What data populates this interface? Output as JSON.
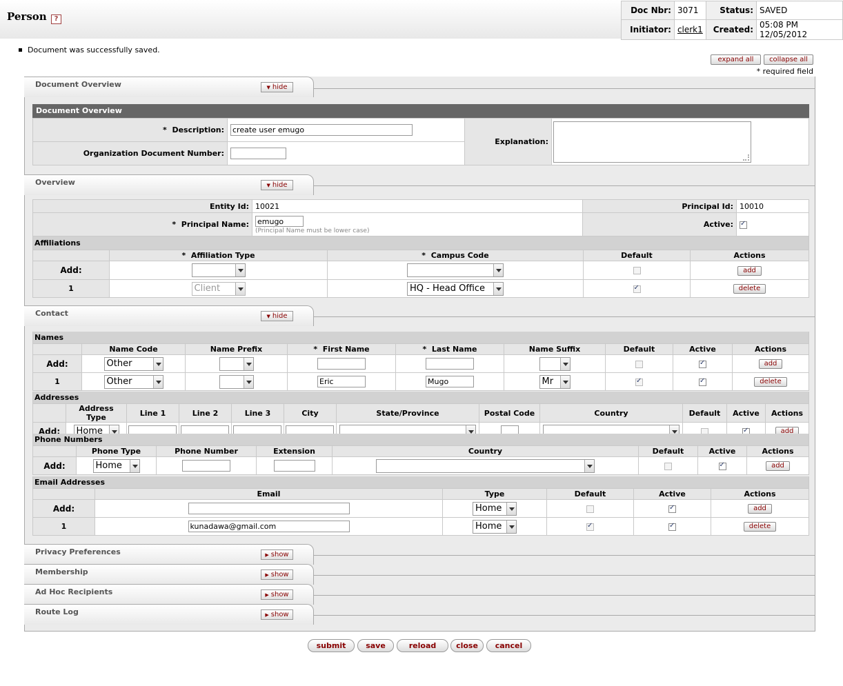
{
  "header": {
    "title": "Person",
    "help": "?",
    "doc_nbr_label": "Doc Nbr:",
    "doc_nbr": "3071",
    "status_label": "Status:",
    "status": "SAVED",
    "initiator_label": "Initiator:",
    "initiator": "clerk1",
    "created_label": "Created:",
    "created": "05:08 PM 12/05/2012"
  },
  "message": "Document was successfully saved.",
  "expand_all": "expand all",
  "collapse_all": "collapse all",
  "required_note": "* required field",
  "tabs": {
    "doc_overview": {
      "label": "Document Overview",
      "btn": "hide"
    },
    "overview": {
      "label": "Overview",
      "btn": "hide"
    },
    "contact": {
      "label": "Contact",
      "btn": "hide"
    },
    "privacy": {
      "label": "Privacy Preferences",
      "btn": "show"
    },
    "membership": {
      "label": "Membership",
      "btn": "show"
    },
    "adhoc": {
      "label": "Ad Hoc Recipients",
      "btn": "show"
    },
    "routelog": {
      "label": "Route Log",
      "btn": "show"
    }
  },
  "doc_overview": {
    "title": "Document Overview",
    "description_label": "Description:",
    "description": "create user emugo",
    "org_doc_label": "Organization Document Number:",
    "org_doc": "",
    "explanation_label": "Explanation:"
  },
  "overview": {
    "entity_id_label": "Entity Id:",
    "entity_id": "10021",
    "principal_id_label": "Principal Id:",
    "principal_id": "10010",
    "principal_name_label": "Principal Name:",
    "principal_name": "emugo",
    "principal_hint": "(Principal Name must be lower case)",
    "active_label": "Active:"
  },
  "affiliations": {
    "title": "Affiliations",
    "cols": [
      "Affiliation Type",
      "Campus Code",
      "Default",
      "Actions"
    ],
    "add_label": "Add:",
    "row_num": "1",
    "row_type": "Client",
    "row_campus": "HQ - Head Office",
    "add_btn": "add",
    "delete_btn": "delete"
  },
  "names": {
    "title": "Names",
    "cols": [
      "Name Code",
      "Name Prefix",
      "First Name",
      "Last Name",
      "Name Suffix",
      "Default",
      "Active",
      "Actions"
    ],
    "add_label": "Add:",
    "add_code": "Other",
    "row_num": "1",
    "row_code": "Other",
    "row_first": "Eric",
    "row_last": "Mugo",
    "row_suffix": "Mr",
    "add_btn": "add",
    "delete_btn": "delete"
  },
  "addresses": {
    "title": "Addresses",
    "cols": [
      "Address Type",
      "Line 1",
      "Line 2",
      "Line 3",
      "City",
      "State/Province",
      "Postal Code",
      "Country",
      "Default",
      "Active",
      "Actions"
    ],
    "add_label": "Add:",
    "add_type": "Home",
    "add_btn": "add"
  },
  "phones": {
    "title": "Phone Numbers",
    "cols": [
      "Phone Type",
      "Phone Number",
      "Extension",
      "Country",
      "Default",
      "Active",
      "Actions"
    ],
    "add_label": "Add:",
    "add_type": "Home",
    "add_btn": "add"
  },
  "emails": {
    "title": "Email Addresses",
    "cols": [
      "Email",
      "Type",
      "Default",
      "Active",
      "Actions"
    ],
    "add_label": "Add:",
    "add_type": "Home",
    "row_num": "1",
    "row_email": "kunadawa@gmail.com",
    "row_type": "Home",
    "add_btn": "add",
    "delete_btn": "delete"
  },
  "bottom_buttons": [
    "submit",
    "save",
    "reload",
    "close",
    "cancel"
  ],
  "colors": {
    "title_bar": "#666666",
    "button_text": "#880000",
    "grid": "#c9c9c9"
  }
}
